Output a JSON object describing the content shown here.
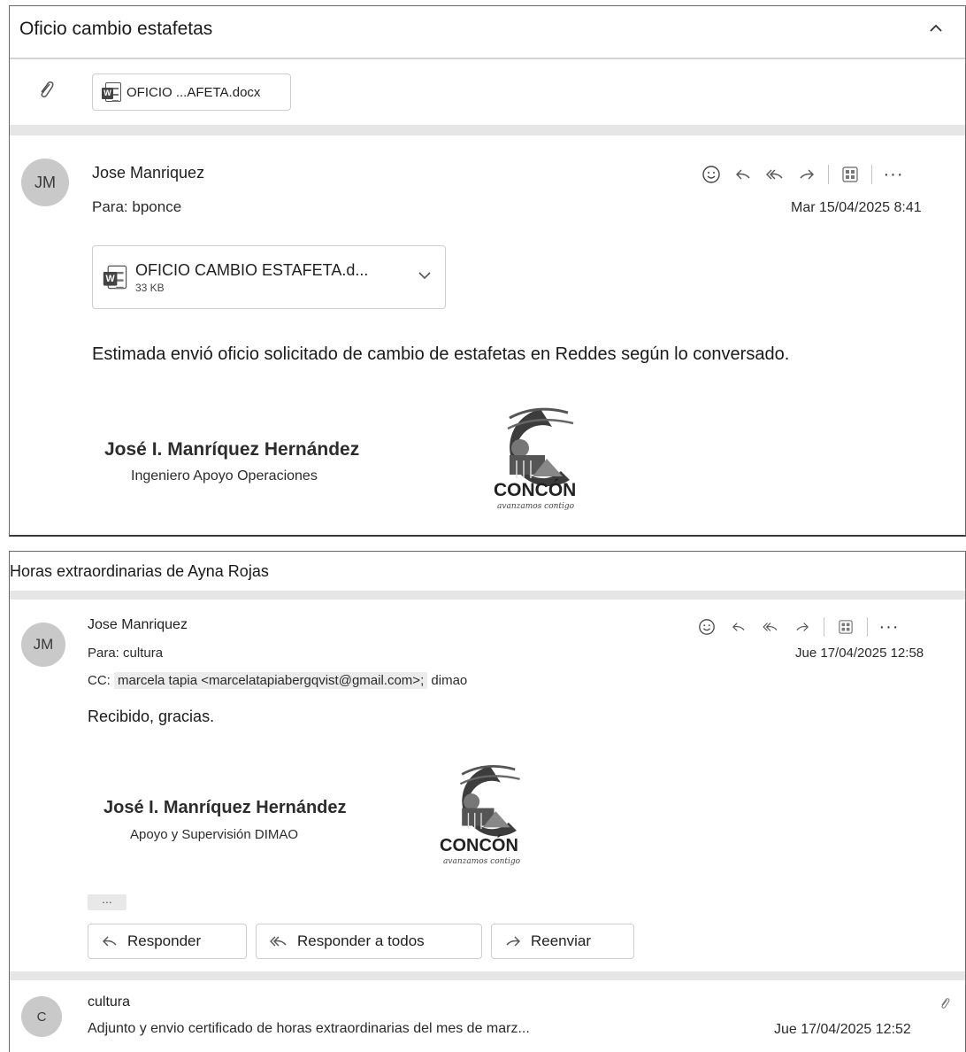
{
  "thread1": {
    "subject": "Oficio cambio estafetas",
    "attachment_chip": "OFICIO ...AFETA.docx",
    "message": {
      "avatar": "JM",
      "sender": "Jose Manriquez",
      "to_label": "Para:",
      "to": "bponce",
      "date": "Mar 15/04/2025 8:41",
      "attachment": {
        "name": "OFICIO CAMBIO ESTAFETA.d...",
        "size": "33 KB"
      },
      "body": "Estimada envió oficio solicitado de cambio de estafetas en Reddes según lo conversado.",
      "signature": {
        "name": "José I. Manríquez Hernández",
        "role": "Ingeniero Apoyo Operaciones"
      },
      "logo": {
        "word": "CONCÓN",
        "tag": "avanzamos contigo"
      }
    }
  },
  "thread2": {
    "subject": "Horas extraordinarias de Ayna Rojas",
    "message": {
      "avatar": "JM",
      "sender": "Jose Manriquez",
      "to_label": "Para:",
      "to": "cultura",
      "cc_label": "CC:",
      "cc_first": "marcela tapia <marcelatapiabergqvist@gmail.com>;",
      "cc_second": "dimao",
      "date": "Jue 17/04/2025 12:58",
      "body": "Recibido, gracias.",
      "signature": {
        "name": "José I. Manríquez Hernández",
        "role": "Apoyo y Supervisión DIMAO"
      },
      "logo": {
        "word": "CONCÓN",
        "tag": "avanzamos contigo"
      },
      "ellipsis": "...",
      "buttons": {
        "reply": "Responder",
        "reply_all": "Responder a todos",
        "forward": "Reenviar"
      }
    },
    "collapsed": {
      "avatar": "C",
      "sender": "cultura",
      "preview": "Adjunto y envio certificado de horas extraordinarias del mes de marz...",
      "date": "Jue 17/04/2025 12:52"
    }
  },
  "icons": [
    "paperclip-icon",
    "word-doc-icon",
    "emoji-icon",
    "reply-icon",
    "reply-all-icon",
    "forward-icon",
    "apps-icon",
    "more-icon",
    "chevron-up-icon",
    "chevron-down-icon"
  ]
}
